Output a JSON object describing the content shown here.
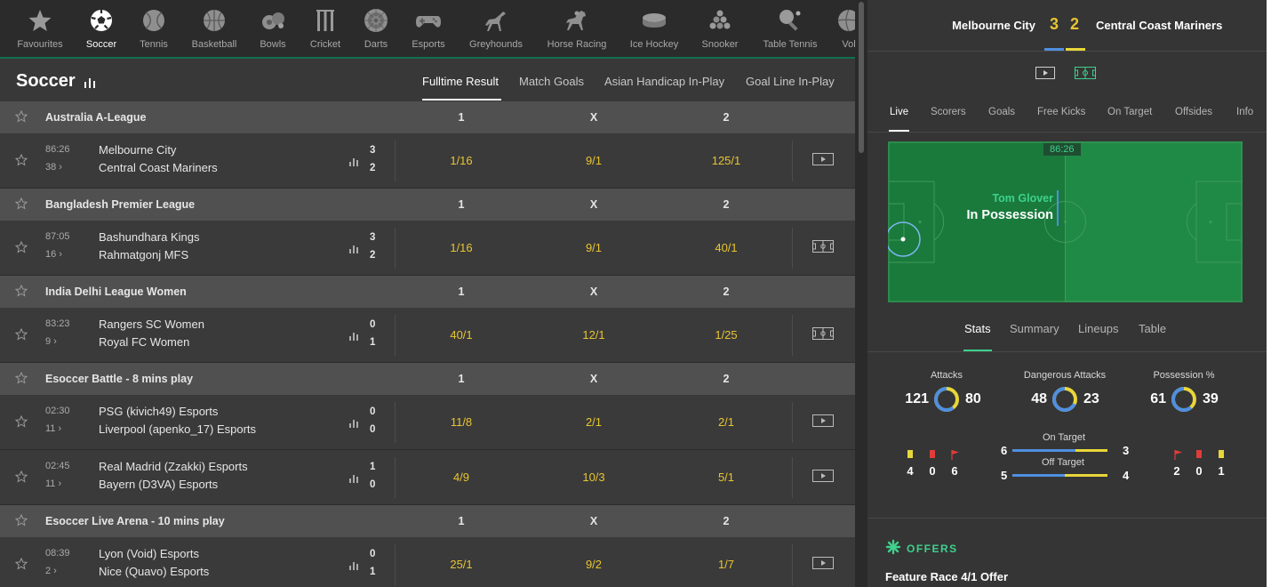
{
  "sports_nav": {
    "items": [
      {
        "label": "Favourites",
        "icon": "star-icon"
      },
      {
        "label": "Soccer",
        "icon": "soccer-ball-icon",
        "active": true
      },
      {
        "label": "Tennis",
        "icon": "tennis-ball-icon"
      },
      {
        "label": "Basketball",
        "icon": "basketball-icon"
      },
      {
        "label": "Bowls",
        "icon": "bowls-icon"
      },
      {
        "label": "Cricket",
        "icon": "cricket-stumps-icon"
      },
      {
        "label": "Darts",
        "icon": "dartboard-icon"
      },
      {
        "label": "Esports",
        "icon": "gamepad-icon"
      },
      {
        "label": "Greyhounds",
        "icon": "greyhound-icon"
      },
      {
        "label": "Horse Racing",
        "icon": "horse-racing-icon"
      },
      {
        "label": "Ice Hockey",
        "icon": "hockey-puck-icon"
      },
      {
        "label": "Snooker",
        "icon": "snooker-balls-icon"
      },
      {
        "label": "Table Tennis",
        "icon": "table-tennis-icon"
      },
      {
        "label": "Vol",
        "icon": "volleyball-icon"
      }
    ]
  },
  "page": {
    "title": "Soccer",
    "market_tabs": [
      {
        "label": "Fulltime Result",
        "active": true
      },
      {
        "label": "Match Goals"
      },
      {
        "label": "Asian Handicap In-Play"
      },
      {
        "label": "Goal Line In-Play"
      }
    ]
  },
  "columns": {
    "home": "1",
    "draw": "X",
    "away": "2"
  },
  "leagues": [
    {
      "name": "Australia A-League",
      "matches": [
        {
          "time": "86:26",
          "minute": "38 ›",
          "team1": "Melbourne City",
          "team2": "Central Coast Mariners",
          "score1": "3",
          "score2": "2",
          "odds": [
            "1/16",
            "9/1",
            "125/1"
          ],
          "media": "video-icon"
        }
      ]
    },
    {
      "name": "Bangladesh Premier League",
      "matches": [
        {
          "time": "87:05",
          "minute": "16 ›",
          "team1": "Bashundhara Kings",
          "team2": "Rahmatgonj MFS",
          "score1": "3",
          "score2": "2",
          "odds": [
            "1/16",
            "9/1",
            "40/1"
          ],
          "media": "pitch-tracker-icon"
        }
      ]
    },
    {
      "name": "India Delhi League Women",
      "matches": [
        {
          "time": "83:23",
          "minute": "9 ›",
          "team1": "Rangers SC Women",
          "team2": "Royal FC Women",
          "score1": "0",
          "score2": "1",
          "odds": [
            "40/1",
            "12/1",
            "1/25"
          ],
          "media": "pitch-tracker-icon"
        }
      ]
    },
    {
      "name": "Esoccer Battle - 8 mins play",
      "matches": [
        {
          "time": "02:30",
          "minute": "11 ›",
          "team1": "PSG (kivich49) Esports",
          "team2": "Liverpool (apenko_17) Esports",
          "score1": "0",
          "score2": "0",
          "odds": [
            "11/8",
            "2/1",
            "2/1"
          ],
          "media": "video-icon"
        },
        {
          "time": "02:45",
          "minute": "11 ›",
          "team1": "Real Madrid (Zzakki) Esports",
          "team2": "Bayern (D3VA) Esports",
          "score1": "1",
          "score2": "0",
          "odds": [
            "4/9",
            "10/3",
            "5/1"
          ],
          "media": "video-icon"
        }
      ]
    },
    {
      "name": "Esoccer Live Arena - 10 mins play",
      "matches": [
        {
          "time": "08:39",
          "minute": "2 ›",
          "team1": "Lyon (Void) Esports",
          "team2": "Nice (Quavo) Esports",
          "score1": "0",
          "score2": "1",
          "odds": [
            "25/1",
            "9/2",
            "1/7"
          ],
          "media": "video-icon"
        }
      ]
    }
  ],
  "match_centre": {
    "home_team": "Melbourne City",
    "away_team": "Central Coast Mariners",
    "home_score": "3",
    "away_score": "2",
    "tabs": [
      {
        "label": "Live",
        "active": true
      },
      {
        "label": "Scorers"
      },
      {
        "label": "Goals"
      },
      {
        "label": "Free Kicks"
      },
      {
        "label": "On Target"
      },
      {
        "label": "Offsides"
      },
      {
        "label": "Info"
      }
    ],
    "pitch": {
      "clock": "86:26",
      "player": "Tom Glover",
      "status": "In Possession"
    },
    "stat_tabs": [
      {
        "label": "Stats",
        "active": true
      },
      {
        "label": "Summary"
      },
      {
        "label": "Lineups"
      },
      {
        "label": "Table"
      }
    ],
    "donuts": [
      {
        "label": "Attacks",
        "home": 121,
        "away": 80
      },
      {
        "label": "Dangerous Attacks",
        "home": 48,
        "away": 23
      },
      {
        "label": "Possession %",
        "home": 61,
        "away": 39
      }
    ],
    "home_cards": {
      "yellow": "4",
      "red": "0",
      "corners": "6"
    },
    "away_cards": {
      "corners": "2",
      "red": "0",
      "yellow": "1"
    },
    "on_target": {
      "label": "On Target",
      "home": 6,
      "away": 3
    },
    "off_target": {
      "label": "Off Target",
      "home": 5,
      "away": 4
    }
  },
  "offers": {
    "title": "OFFERS",
    "item": "Feature Race 4/1 Offer"
  },
  "colors": {
    "accent_green": "#3ed18c",
    "odds_yellow": "#e8c531",
    "home_blue": "#4f8fe0",
    "away_yellow": "#e8d63a",
    "pitch_green": "#1f8a45"
  }
}
